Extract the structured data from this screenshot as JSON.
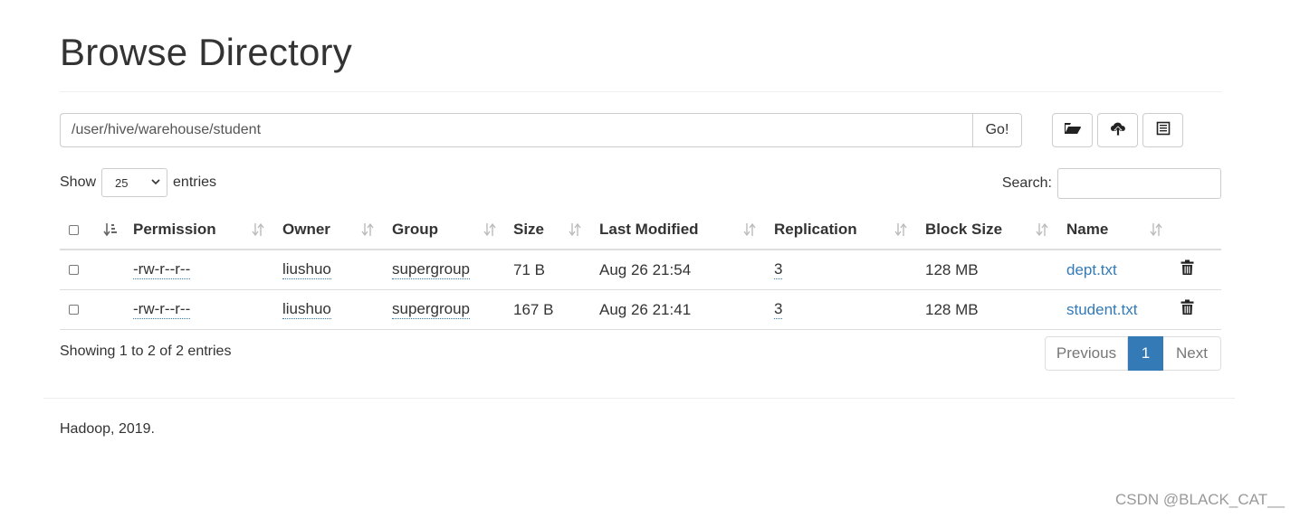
{
  "page": {
    "title": "Browse Directory",
    "path_value": "/user/hive/warehouse/student",
    "go_label": "Go!",
    "toolbar_icons": [
      "folder-open-icon",
      "cloud-upload-icon",
      "list-alt-icon"
    ]
  },
  "table_controls": {
    "show_label": "Show",
    "page_length": "25",
    "entries_label": "entries",
    "search_label": "Search:",
    "search_value": ""
  },
  "columns": [
    "Permission",
    "Owner",
    "Group",
    "Size",
    "Last Modified",
    "Replication",
    "Block Size",
    "Name"
  ],
  "rows": [
    {
      "permission": "-rw-r--r--",
      "owner": "liushuo",
      "group": "supergroup",
      "size": "71 B",
      "last_modified": "Aug 26 21:54",
      "replication": "3",
      "block_size": "128 MB",
      "name": "dept.txt"
    },
    {
      "permission": "-rw-r--r--",
      "owner": "liushuo",
      "group": "supergroup",
      "size": "167 B",
      "last_modified": "Aug 26 21:41",
      "replication": "3",
      "block_size": "128 MB",
      "name": "student.txt"
    }
  ],
  "pagination": {
    "info": "Showing 1 to 2 of 2 entries",
    "previous": "Previous",
    "current": "1",
    "next": "Next"
  },
  "footer": "Hadoop, 2019.",
  "watermark": "CSDN @BLACK_CAT__",
  "colors": {
    "link": "#337ab7",
    "active_page": "#337ab7",
    "border": "#dddddd"
  }
}
